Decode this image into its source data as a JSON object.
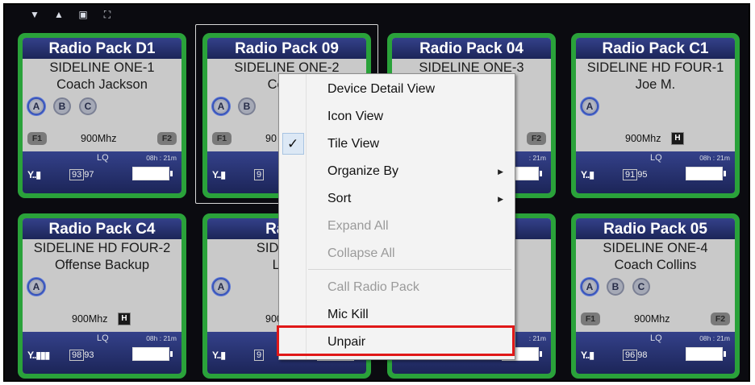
{
  "toolbar": {
    "icons": [
      "triangle-down-icon",
      "triangle-up-icon",
      "window-square-icon",
      "fullscreen-icon"
    ]
  },
  "cards": [
    {
      "title": "Radio Pack D1",
      "line1": "SIDELINE ONE-1",
      "line2": "Coach Jackson",
      "circles": [
        "A",
        "B",
        "C"
      ],
      "f1": "F1",
      "f2": "F2",
      "freq": "900Mhz",
      "h": "",
      "lq_label": "LQ",
      "time": "08h : 21m",
      "lq_box": "93",
      "lq_val": "97",
      "signal": "Y..▮"
    },
    {
      "title": "Radio Pack 09",
      "line1": "SIDELINE ONE-2",
      "line2": "Coach",
      "circles": [
        "A",
        "B"
      ],
      "f1": "F1",
      "f2": "",
      "freq": "90",
      "h": "",
      "lq_label": "",
      "time": "",
      "lq_box": "9",
      "lq_val": "",
      "signal": "Y..▮"
    },
    {
      "title": "Radio Pack 04",
      "line1": "SIDELINE ONE-3",
      "line2": "es",
      "circles": [],
      "f1": "",
      "f2": "F2",
      "freq": "",
      "h": "",
      "lq_label": "",
      "time": ": 21m",
      "lq_box": "",
      "lq_val": "",
      "signal": ""
    },
    {
      "title": "Radio Pack C1",
      "line1": "SIDELINE HD FOUR-1",
      "line2": "Joe M.",
      "circles": [
        "A"
      ],
      "f1": "",
      "f2": "",
      "freq": "900Mhz",
      "h": "H",
      "lq_label": "LQ",
      "time": "08h : 21m",
      "lq_box": "91",
      "lq_val": "95",
      "signal": "Y..▮"
    },
    {
      "title": "Radio Pack C4",
      "line1": "SIDELINE HD FOUR-2",
      "line2": "Offense Backup",
      "circles": [
        "A"
      ],
      "f1": "",
      "f2": "",
      "freq": "900Mhz",
      "h": "H",
      "lq_label": "LQ",
      "time": "08h : 21m",
      "lq_box": "98",
      "lq_val": "93",
      "signal": "Y..▮▮▮"
    },
    {
      "title": "Radio",
      "line1": "SIDELINE",
      "line2": "Lawr",
      "circles": [
        "A"
      ],
      "f1": "",
      "f2": "",
      "freq": "900",
      "h": "",
      "lq_label": "",
      "time": "",
      "lq_box": "9",
      "lq_val": "",
      "signal": "Y..▮"
    },
    {
      "title": "C3",
      "line1": "UR-4",
      "line2": "ıp",
      "circles": [],
      "f1": "",
      "f2": "",
      "freq": "",
      "h": "",
      "lq_label": "",
      "time": ": 21m",
      "lq_box": "",
      "lq_val": "",
      "signal": ""
    },
    {
      "title": "Radio Pack 05",
      "line1": "SIDELINE ONE-4",
      "line2": "Coach Collins",
      "circles": [
        "A",
        "B",
        "C"
      ],
      "f1": "F1",
      "f2": "F2",
      "freq": "900Mhz",
      "h": "",
      "lq_label": "LQ",
      "time": "08h : 21m",
      "lq_box": "96",
      "lq_val": "98",
      "signal": "Y..▮"
    }
  ],
  "menu": {
    "items": [
      {
        "label": "Device Detail View",
        "enabled": true,
        "checked": false,
        "submenu": false
      },
      {
        "label": "Icon View",
        "enabled": true,
        "checked": false,
        "submenu": false
      },
      {
        "label": "Tile View",
        "enabled": true,
        "checked": true,
        "submenu": false
      },
      {
        "label": "Organize By",
        "enabled": true,
        "checked": false,
        "submenu": true
      },
      {
        "label": "Sort",
        "enabled": true,
        "checked": false,
        "submenu": true
      },
      {
        "label": "Expand All",
        "enabled": false,
        "checked": false,
        "submenu": false
      },
      {
        "label": "Collapse All",
        "enabled": false,
        "checked": false,
        "submenu": false
      },
      {
        "label": "Call Radio Pack",
        "enabled": false,
        "checked": false,
        "submenu": false
      },
      {
        "label": "Mic Kill",
        "enabled": true,
        "checked": false,
        "submenu": false
      },
      {
        "label": "Unpair",
        "enabled": true,
        "checked": false,
        "submenu": false
      }
    ],
    "check_glyph": "✓",
    "arrow_glyph": "▶"
  },
  "colors": {
    "card_border": "#2aa23a",
    "title_bar": "#283370",
    "highlight": "#e01818"
  }
}
